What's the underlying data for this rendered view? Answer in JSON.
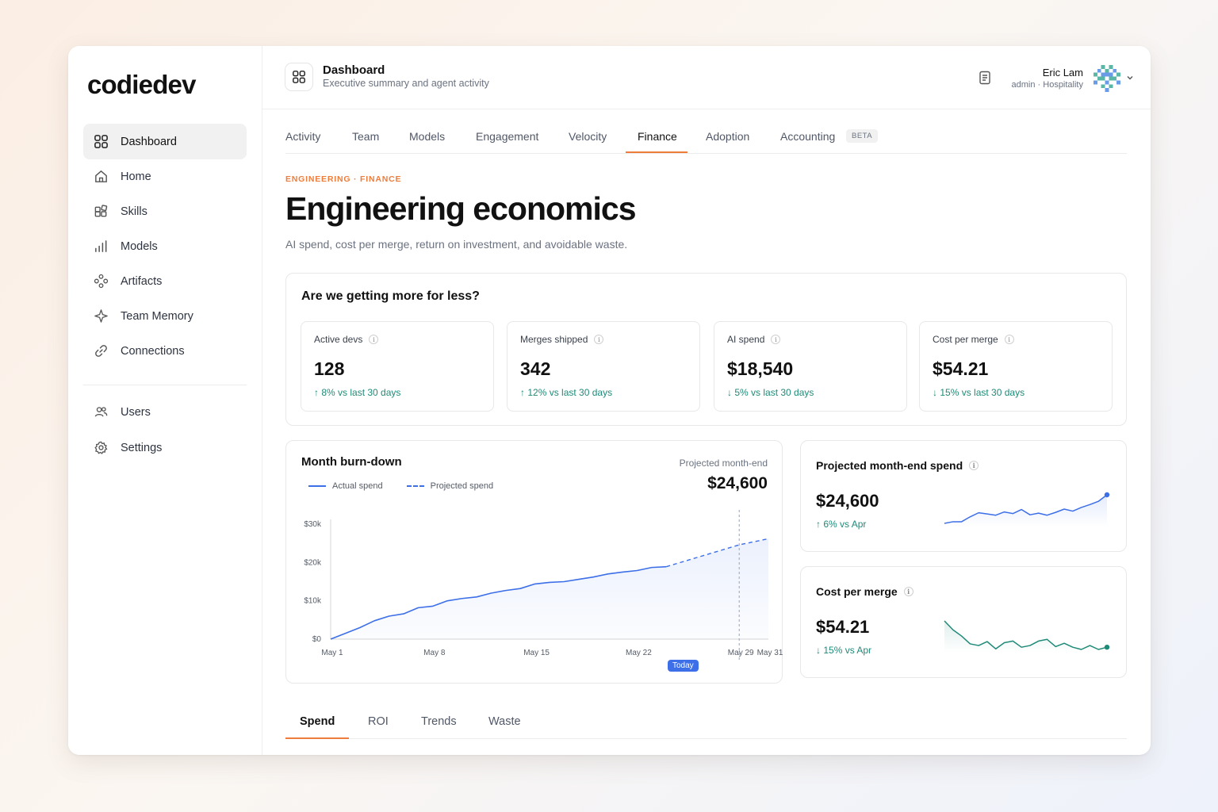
{
  "app": {
    "logo": "codiedev"
  },
  "sidebar": {
    "items": [
      {
        "label": "Dashboard",
        "icon": "dashboard-grid-icon",
        "active": true
      },
      {
        "label": "Home",
        "icon": "home-icon"
      },
      {
        "label": "Skills",
        "icon": "skills-blocks-icon"
      },
      {
        "label": "Models",
        "icon": "bar-chart-icon"
      },
      {
        "label": "Artifacts",
        "icon": "artifacts-icon"
      },
      {
        "label": "Team Memory",
        "icon": "sparkle-icon"
      },
      {
        "label": "Connections",
        "icon": "link-icon"
      },
      {
        "label": "Users",
        "icon": "users-icon"
      },
      {
        "label": "Settings",
        "icon": "gear-icon"
      }
    ]
  },
  "header": {
    "title": "Dashboard",
    "subtitle": "Executive summary and agent activity",
    "user": {
      "name": "Eric Lam",
      "role": "admin · Hospitality"
    }
  },
  "tabs": [
    {
      "label": "Activity"
    },
    {
      "label": "Team"
    },
    {
      "label": "Models"
    },
    {
      "label": "Engagement"
    },
    {
      "label": "Velocity"
    },
    {
      "label": "Finance",
      "active": true
    },
    {
      "label": "Adoption"
    },
    {
      "label": "Accounting",
      "badge": "BETA"
    }
  ],
  "page": {
    "eyebrow": "ENGINEERING · FINANCE",
    "title": "Engineering economics",
    "subtitle": "AI spend, cost per merge, return on investment, and avoidable waste."
  },
  "kpis": {
    "question": "Are we getting more for less?",
    "cards": [
      {
        "label": "Active devs",
        "value": "128",
        "delta": "8% vs last 30 days",
        "direction": "up"
      },
      {
        "label": "Merges shipped",
        "value": "342",
        "delta": "12% vs last 30 days",
        "direction": "up"
      },
      {
        "label": "AI spend",
        "value": "$18,540",
        "delta": "5% vs last 30 days",
        "direction": "down"
      },
      {
        "label": "Cost per merge",
        "value": "$54.21",
        "delta": "15% vs last 30 days",
        "direction": "down"
      }
    ]
  },
  "burndown": {
    "title": "Month burn-down",
    "projected_label": "Projected month-end",
    "projected_value": "$24,600",
    "today_label": "Today"
  },
  "chart_data": [
    {
      "type": "line",
      "title": "Month burn-down",
      "series": [
        {
          "name": "Actual spend",
          "x": [
            "May 1",
            "May 2",
            "May 3",
            "May 4",
            "May 5",
            "May 6",
            "May 7",
            "May 8",
            "May 9",
            "May 10",
            "May 11",
            "May 12",
            "May 13",
            "May 14",
            "May 15",
            "May 16",
            "May 17",
            "May 18",
            "May 19",
            "May 20",
            "May 21",
            "May 22",
            "May 23",
            "May 24"
          ],
          "values": [
            0,
            1500,
            3000,
            4800,
            6000,
            6600,
            8200,
            8600,
            10000,
            10600,
            11000,
            12000,
            12700,
            13200,
            14400,
            14800,
            15000,
            15600,
            16200,
            17000,
            17500,
            17900,
            18700,
            18900
          ]
        },
        {
          "name": "Projected spend",
          "x": [
            "May 24",
            "May 29",
            "May 31"
          ],
          "values": [
            18900,
            24600,
            26200
          ]
        }
      ],
      "x_ticks": [
        "May 1",
        "May 8",
        "May 15",
        "May 22",
        "May 29",
        "May 31"
      ],
      "y_ticks": [
        "$0",
        "$10k",
        "$20k",
        "$30k"
      ],
      "ylim": [
        0,
        30000
      ],
      "marker": {
        "label": "Today",
        "x": "May 29"
      },
      "legend": "top-left",
      "colors": {
        "line": "#3c6fe8"
      }
    },
    {
      "type": "line",
      "title": "Projected month-end spend",
      "series": [
        {
          "values": [
            3.0,
            3.4,
            3.4,
            4.6,
            5.6,
            5.3,
            5.0,
            5.8,
            5.4,
            6.4,
            5.1,
            5.5,
            5.0,
            5.7,
            6.5,
            6.0,
            6.9,
            7.6,
            8.4,
            10.0
          ]
        }
      ],
      "colors": {
        "line": "#3c6fe8"
      }
    },
    {
      "type": "line",
      "title": "Cost per merge",
      "series": [
        {
          "values": [
            9.5,
            7.9,
            6.8,
            5.4,
            5.1,
            5.8,
            4.5,
            5.6,
            5.9,
            4.8,
            5.1,
            5.9,
            6.2,
            4.9,
            5.5,
            4.8,
            4.4,
            5.1,
            4.4,
            4.8
          ]
        }
      ],
      "colors": {
        "line": "#1f8a78"
      }
    }
  ],
  "mini_cards": [
    {
      "title": "Projected month-end spend",
      "value": "$24,600",
      "delta": "6% vs Apr",
      "direction": "up"
    },
    {
      "title": "Cost per merge",
      "value": "$54.21",
      "delta": "15% vs Apr",
      "direction": "down"
    }
  ],
  "bottom_tabs": [
    {
      "label": "Spend",
      "active": true
    },
    {
      "label": "ROI"
    },
    {
      "label": "Trends"
    },
    {
      "label": "Waste"
    }
  ],
  "colors": {
    "accent": "#ee7d3b",
    "line": "#3c6fe8",
    "positive": "#1f8a78"
  }
}
